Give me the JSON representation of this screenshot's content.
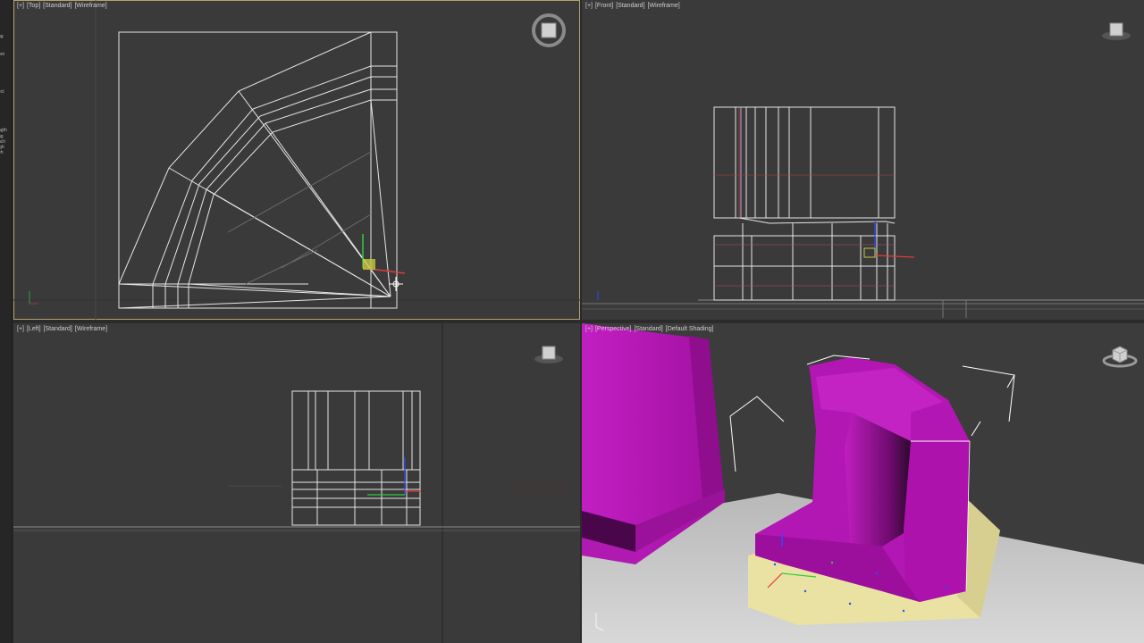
{
  "side_panel": {
    "items": [
      "ng",
      "ont",
      "ect",
      "ngth",
      "ng",
      "nch",
      "igh",
      "eh"
    ]
  },
  "viewports": {
    "top": {
      "label": {
        "plus": "[+]",
        "view": "[Top]",
        "mode": "[Standard]",
        "shading": "[Wireframe]"
      },
      "viewcube_icon": "steering-wheel-cube-icon"
    },
    "front": {
      "label": {
        "plus": "[+]",
        "view": "[Front]",
        "mode": "[Standard]",
        "shading": "[Wireframe]"
      },
      "viewcube_icon": "viewcube-icon"
    },
    "left": {
      "label": {
        "plus": "[+]",
        "view": "[Left]",
        "mode": "[Standard]",
        "shading": "[Wireframe]"
      },
      "viewcube_icon": "viewcube-icon"
    },
    "perspective": {
      "label": {
        "plus": "[+]",
        "view": "[Perspective]",
        "mode": "[Standard]",
        "shading": "[Default Shading]"
      },
      "viewcube_icon": "viewcube-icon"
    }
  },
  "colors": {
    "viewport_bg": "#3a3a3a",
    "wire_white": "#e6e6e6",
    "wire_grid": "#5c5c5c",
    "magenta": "#b81ab8",
    "base_yellow": "#e8e0a0",
    "floor_grey": "#c8c8c8",
    "active_border": "#b5a36a"
  }
}
